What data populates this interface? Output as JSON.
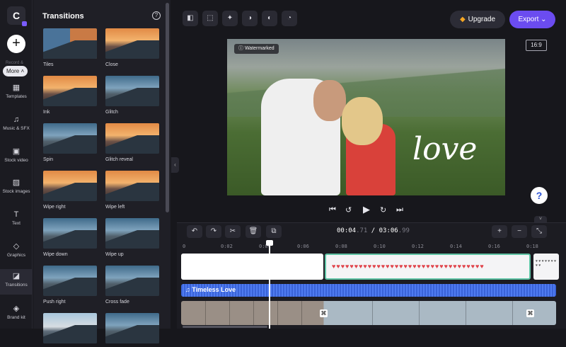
{
  "app": {
    "logo_text": "C"
  },
  "rail": {
    "more_label": "More",
    "ghost_label": "Record &",
    "items": [
      {
        "label": "Templates",
        "icon": "templates-icon",
        "glyph": "▦"
      },
      {
        "label": "Music & SFX",
        "icon": "music-icon",
        "glyph": "♫"
      },
      {
        "label": "Stock video",
        "icon": "stock-video-icon",
        "glyph": "▣"
      },
      {
        "label": "Stock images",
        "icon": "stock-images-icon",
        "glyph": "▨"
      },
      {
        "label": "Text",
        "icon": "text-icon",
        "glyph": "T"
      },
      {
        "label": "Graphics",
        "icon": "graphics-icon",
        "glyph": "◇"
      },
      {
        "label": "Transitions",
        "icon": "transitions-icon",
        "glyph": "◪",
        "active": true
      },
      {
        "label": "Brand kit",
        "icon": "brand-kit-icon",
        "glyph": "◈"
      }
    ]
  },
  "panel": {
    "title": "Transitions",
    "help_glyph": "?",
    "tiles": [
      {
        "label": "Tiles",
        "style": "split"
      },
      {
        "label": "Close",
        "style": "warm"
      },
      {
        "label": "Ink",
        "style": "warm"
      },
      {
        "label": "Glitch",
        "style": ""
      },
      {
        "label": "Spin",
        "style": ""
      },
      {
        "label": "Glitch reveal",
        "style": "warm"
      },
      {
        "label": "Wipe right",
        "style": "warm"
      },
      {
        "label": "Wipe left",
        "style": "warm"
      },
      {
        "label": "Wipe down",
        "style": ""
      },
      {
        "label": "Wipe up",
        "style": ""
      },
      {
        "label": "Push right",
        "style": ""
      },
      {
        "label": "Cross fade",
        "style": ""
      },
      {
        "label": "",
        "style": "dusk"
      },
      {
        "label": "",
        "style": ""
      }
    ]
  },
  "toolbar": {
    "buttons": [
      {
        "name": "layout-button",
        "glyph": "◧"
      },
      {
        "name": "crop-button",
        "glyph": "⬚"
      },
      {
        "name": "magic-button",
        "glyph": "✦"
      },
      {
        "name": "filters-button",
        "glyph": "◑"
      },
      {
        "name": "adjust-button",
        "glyph": "◐"
      },
      {
        "name": "speed-button",
        "glyph": "◔"
      }
    ],
    "upgrade_label": "Upgrade",
    "upgrade_glyph": "◆",
    "export_label": "Export",
    "export_caret": "⌄",
    "ratio_label": "16:9"
  },
  "preview": {
    "watermark_label": "Watermarked",
    "watermark_glyph": "ⓘ",
    "overlay_text": "love"
  },
  "playback": {
    "skip_back": "⏮",
    "back5": "↺",
    "play": "▶",
    "fwd5": "↻",
    "skip_fwd": "⏭"
  },
  "timeline": {
    "undo": "↶",
    "redo": "↷",
    "cut": "✂",
    "delete": "🗑",
    "duplicate": "⧉",
    "time_current_main": "00:04",
    "time_current_frac": ".71",
    "time_sep": " / ",
    "time_total_main": "03:06",
    "time_total_frac": ".99",
    "zoom_in": "+",
    "zoom_out": "−",
    "fit": "⤡",
    "ruler": [
      "0",
      "0:02",
      "0:04",
      "0:06",
      "0:08",
      "0:10",
      "0:12",
      "0:14",
      "0:16",
      "0:18"
    ],
    "hearts_text": "♥♥♥♥♥♥♥♥♥♥♥♥♥♥♥♥♥♥♥♥♥♥♥♥♥♥♥♥♥♥♥♥♥♥",
    "right_clip_text": "♥ ♥ ♥ ♥ ♥ ♥ ♥ ♥ ♥",
    "audio_label": "♫  Timeless Love",
    "transition_glyph": "⌘"
  },
  "help_glyph": "?"
}
